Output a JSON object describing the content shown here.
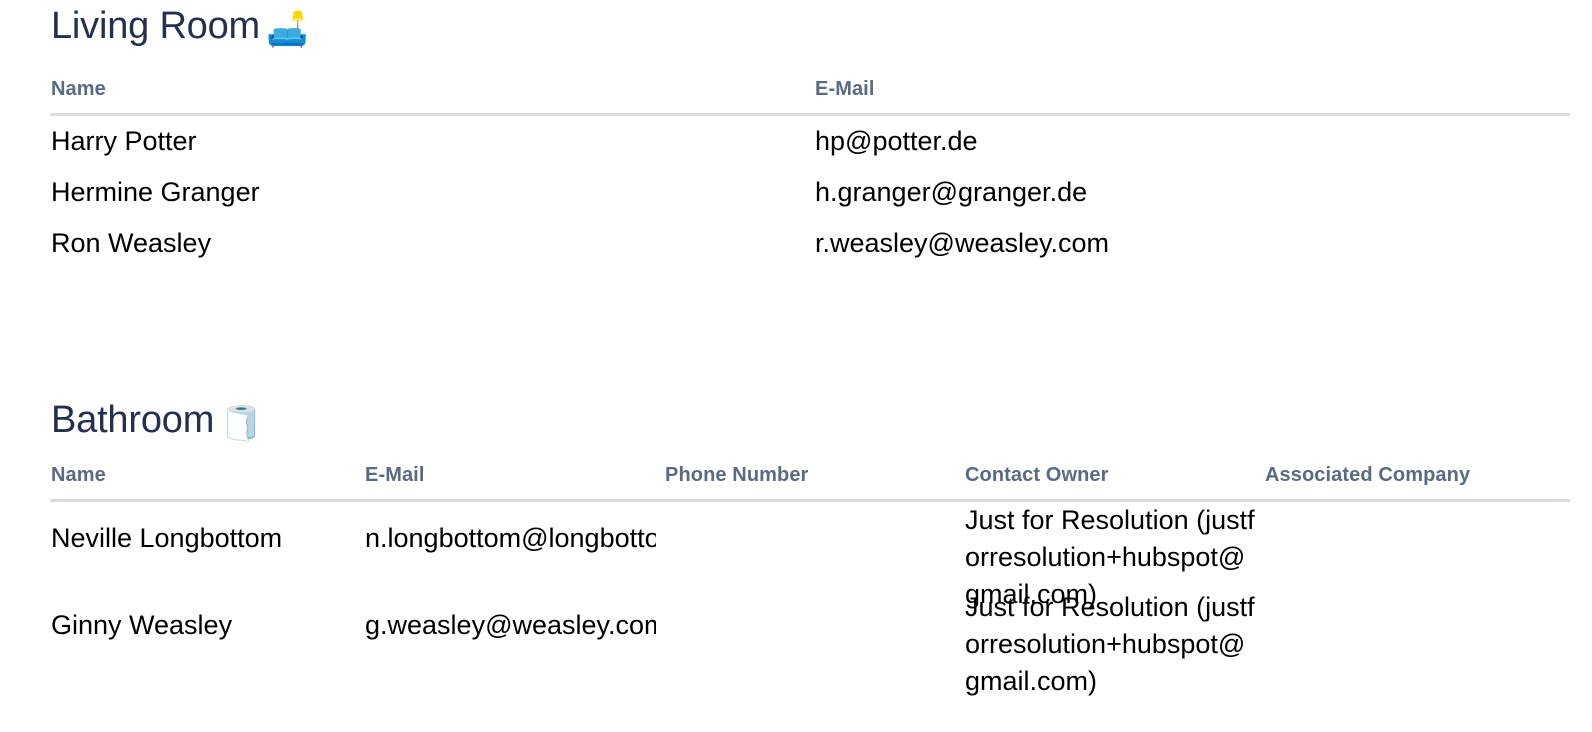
{
  "sections": [
    {
      "id": "living-room",
      "title": "Living Room",
      "emoji": "🛋️",
      "emoji_name": "couch-and-lamp-emoji",
      "columns": [
        "Name",
        "E-Mail"
      ],
      "rows": [
        [
          "Harry Potter",
          "hp@potter.de"
        ],
        [
          "Hermine Granger",
          "h.granger@granger.de"
        ],
        [
          "Ron Weasley",
          "r.weasley@weasley.com"
        ]
      ]
    },
    {
      "id": "bathroom",
      "title": "Bathroom",
      "emoji": "🧻",
      "emoji_name": "roll-of-paper-emoji",
      "columns": [
        "Name",
        "E-Mail",
        "Phone Number",
        "Contact Owner",
        "Associated Company"
      ],
      "rows": [
        [
          "Neville Longbottom",
          "n.longbottom@longbottom.de",
          "",
          "Just for Resolution (justforresolution+hubspot@gmail.com)",
          ""
        ],
        [
          "Ginny Weasley",
          "g.weasley@weasley.com",
          "",
          "Just for Resolution (justforresolution+hubspot@gmail.com)",
          ""
        ]
      ]
    }
  ],
  "colors": {
    "heading": "#233050",
    "column_header": "#5a6a85",
    "divider": "#dcdde4",
    "body_text": "#000000",
    "background": "#ffffff"
  }
}
